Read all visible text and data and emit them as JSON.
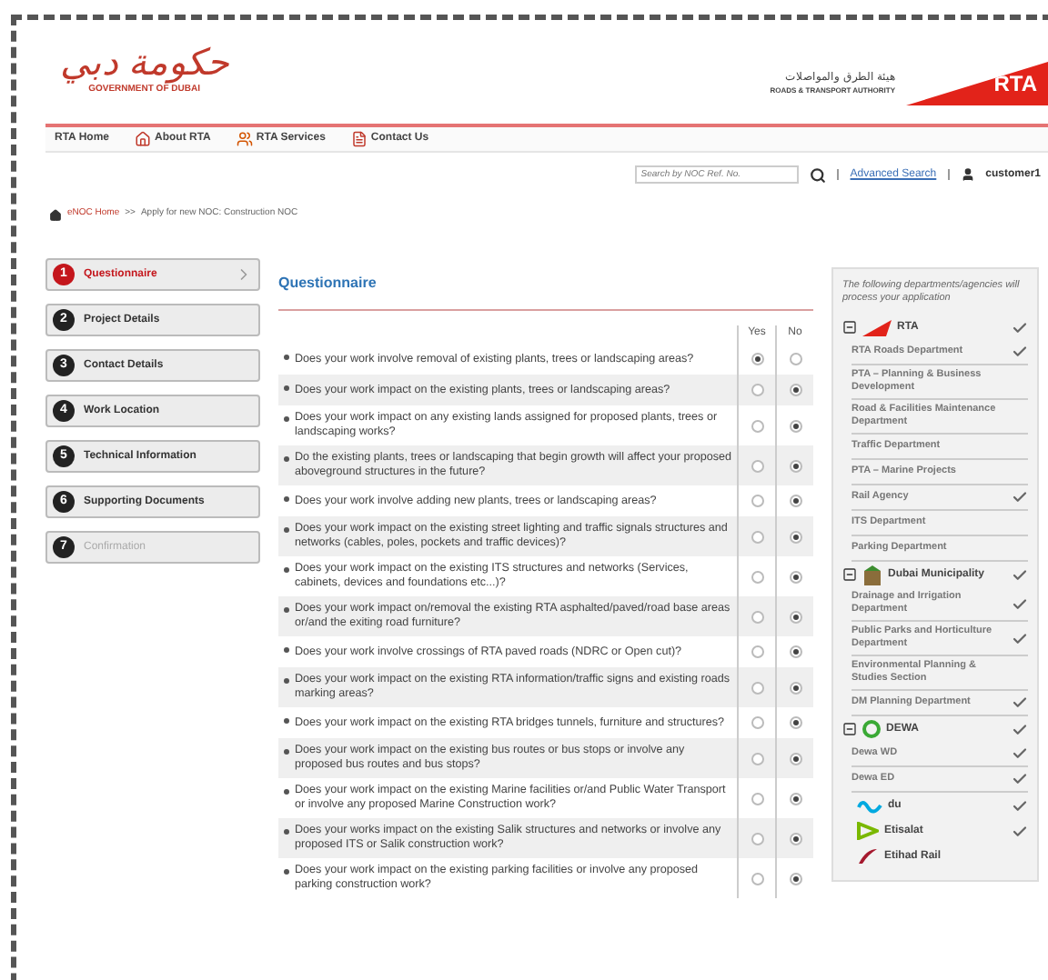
{
  "header": {
    "gov_logo_arabic": "حكومة دبي",
    "gov_logo_english": "GOVERNMENT OF DUBAI",
    "rta_arabic": "هيئة الطرق والمواصلات",
    "rta_english": "ROADS & TRANSPORT AUTHORITY",
    "rta_logo": "RTA"
  },
  "nav": [
    {
      "label": "RTA Home",
      "kind": "plain"
    },
    {
      "label": "About RTA",
      "kind": "house"
    },
    {
      "label": "RTA Services",
      "kind": "people"
    },
    {
      "label": "Contact Us",
      "kind": "contact"
    }
  ],
  "search": {
    "placeholder": "Search by NOC Ref. No.",
    "advanced_link": "Advanced Search",
    "user": "customer1"
  },
  "breadcrumb": {
    "home": "eNOC Home",
    "separator": ">>",
    "current": "Apply for new NOC: Construction NOC"
  },
  "steps": [
    {
      "number": "1",
      "label": "Questionnaire",
      "selected": true,
      "disabled": false
    },
    {
      "number": "2",
      "label": "Project Details",
      "selected": false,
      "disabled": false
    },
    {
      "number": "3",
      "label": "Contact Details",
      "selected": false,
      "disabled": false
    },
    {
      "number": "4",
      "label": "Work Location",
      "selected": false,
      "disabled": false
    },
    {
      "number": "5",
      "label": "Technical Information",
      "selected": false,
      "disabled": false
    },
    {
      "number": "6",
      "label": "Supporting Documents",
      "selected": false,
      "disabled": false
    },
    {
      "number": "7",
      "label": "Confirmation",
      "selected": false,
      "disabled": true
    }
  ],
  "questionnaire": {
    "title": "Questionnaire",
    "yes_header": "Yes",
    "no_header": "No",
    "questions": [
      {
        "text": "Does your work involve removal of existing plants, trees or landscaping areas?",
        "yes": true
      },
      {
        "text": "Does your work impact on the existing plants, trees or landscaping areas?",
        "yes": false
      },
      {
        "text": "Does your work impact on any existing lands assigned for proposed plants, trees or landscaping works?",
        "yes": false
      },
      {
        "text": "Do the existing plants, trees or landscaping that begin growth will affect your proposed aboveground structures in the future?",
        "yes": false
      },
      {
        "text": "Does your work involve adding new plants, trees or landscaping areas?",
        "yes": false
      },
      {
        "text": "Does your work impact on the existing street lighting and traffic signals structures and networks (cables, poles, pockets and traffic devices)?",
        "yes": false
      },
      {
        "text": "Does your work impact on the existing ITS structures and networks (Services, cabinets, devices and foundations etc...)?",
        "yes": false
      },
      {
        "text": "Does your work impact on/removal the existing RTA asphalted/paved/road base areas or/and the exiting road furniture?",
        "yes": false
      },
      {
        "text": "Does your work involve crossings of RTA paved roads (NDRC or Open cut)?",
        "yes": false
      },
      {
        "text": "Does your work impact on the existing RTA information/traffic signs and existing roads marking areas?",
        "yes": false
      },
      {
        "text": "Does your work impact on the existing RTA bridges tunnels, furniture and structures?",
        "yes": false
      },
      {
        "text": "Does your work impact on the existing bus routes or bus stops or involve any proposed bus routes and bus stops?",
        "yes": false
      },
      {
        "text": "Does your work impact on the existing Marine facilities or/and Public Water Transport or involve any proposed Marine Construction work?",
        "yes": false
      },
      {
        "text": "Does your works impact on the existing Salik structures and networks or involve any proposed ITS or Salik construction work?",
        "yes": false
      },
      {
        "text": "Does your work impact on the existing parking facilities or involve any proposed parking construction work?",
        "yes": false
      }
    ]
  },
  "departments": {
    "intro": "The following departments/agencies will process your application",
    "groups": [
      {
        "name": "RTA",
        "kind": "rta",
        "expanded": true,
        "checked": true,
        "children": [
          {
            "name": "RTA Roads Department",
            "checked": true
          },
          {
            "name": "PTA – Planning & Business Development",
            "checked": false
          },
          {
            "name": "Road & Facilities Maintenance Department",
            "checked": false
          },
          {
            "name": "Traffic Department",
            "checked": false
          },
          {
            "name": "PTA – Marine Projects",
            "checked": false
          },
          {
            "name": "Rail Agency",
            "checked": true
          },
          {
            "name": "ITS Department",
            "checked": false
          },
          {
            "name": "Parking Department",
            "checked": false
          }
        ]
      },
      {
        "name": "Dubai Municipality",
        "kind": "municipality",
        "expanded": true,
        "checked": true,
        "children": [
          {
            "name": "Drainage and Irrigation Department",
            "checked": true
          },
          {
            "name": "Public Parks and Horticulture Department",
            "checked": true
          },
          {
            "name": "Environmental Planning & Studies Section",
            "checked": false
          },
          {
            "name": "DM Planning Department",
            "checked": true
          }
        ]
      },
      {
        "name": "DEWA",
        "kind": "dewa",
        "expanded": true,
        "checked": true,
        "children": [
          {
            "name": "Dewa WD",
            "checked": true
          },
          {
            "name": "Dewa ED",
            "checked": true
          }
        ]
      },
      {
        "name": "du",
        "kind": "du",
        "checked": true
      },
      {
        "name": "Etisalat",
        "kind": "etisalat",
        "checked": true
      },
      {
        "name": "Etihad Rail",
        "kind": "etihad",
        "checked": false
      }
    ]
  }
}
